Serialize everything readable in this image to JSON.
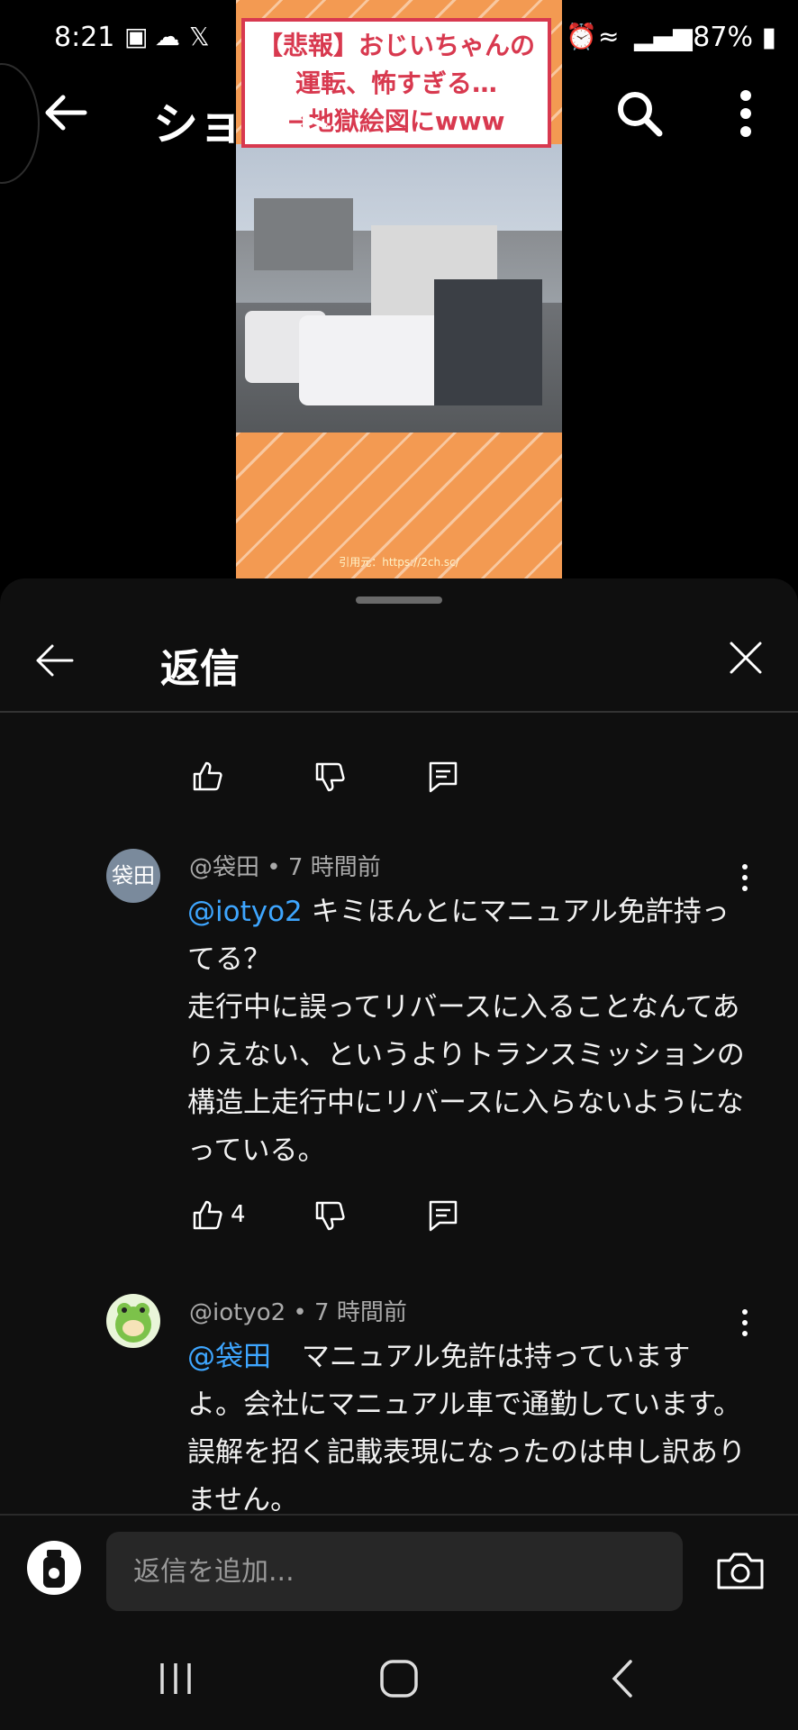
{
  "status_bar": {
    "time": "8:21",
    "battery": "87%"
  },
  "top_bar": {
    "title": "ショート"
  },
  "video": {
    "caption_line1": "【悲報】おじいちゃんの",
    "caption_line2": "運転、怖すぎる…",
    "caption_line3": "→地獄絵図にwww",
    "source": "引用元：https://2ch.sc/"
  },
  "panel": {
    "title": "返信"
  },
  "comments": [
    {
      "avatar_text": "袋田",
      "author": "@袋田",
      "time": "7 時間前",
      "mention": "@iotyo2",
      "text": "キミほんとにマニュアル免許持ってる？\n走行中に誤ってリバースに入ることなんてありえない、というよりトランスミッションの構造上走行中にリバースに入らないようになっている。",
      "likes": "4"
    },
    {
      "author": "@iotyo2",
      "time": "7 時間前",
      "mention": "@袋田",
      "text": "マニュアル免許は持っていますよ。会社にマニュアル車で通勤しています。誤解を招く記載表現になったのは申し訳ありません。"
    }
  ],
  "input": {
    "placeholder": "返信を追加..."
  },
  "colors": {
    "mention": "#3ea6ff",
    "panel_bg": "#0f0f0f",
    "caption_red": "#d8394f"
  }
}
